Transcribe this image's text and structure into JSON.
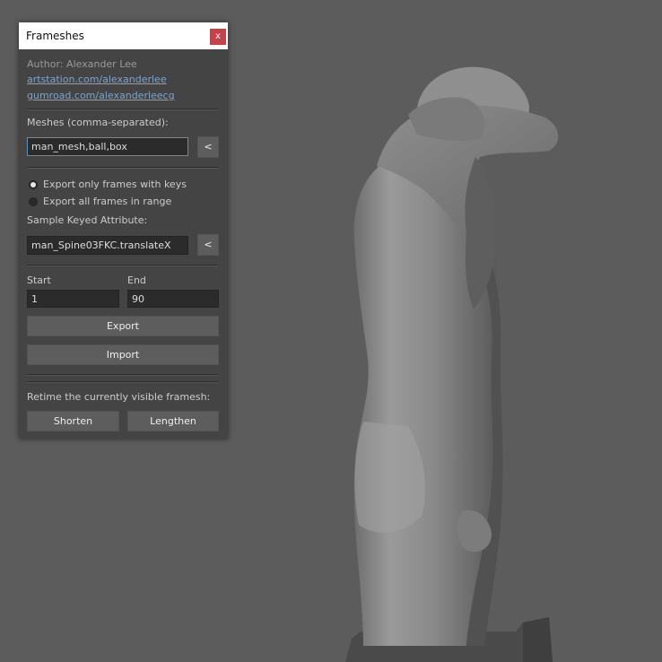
{
  "window": {
    "title": "Frameshes",
    "close_label": "x"
  },
  "author": {
    "text": "Author: Alexander Lee",
    "link1": "artstation.com/alexanderlee",
    "link2": "gumroad.com/alexanderleecg"
  },
  "meshes": {
    "label": "Meshes (comma-separated):",
    "value": "man_mesh,ball,box",
    "pick_label": "<"
  },
  "export_mode": {
    "option1": "Export only frames with keys",
    "option2": "Export all frames in range",
    "selected": "option1"
  },
  "sample_attr": {
    "label": "Sample Keyed Attribute:",
    "value": "man_Spine03FKC.translateX",
    "pick_label": "<"
  },
  "range": {
    "start_label": "Start",
    "end_label": "End",
    "start_value": "1",
    "end_value": "90"
  },
  "actions": {
    "export_label": "Export",
    "import_label": "Import"
  },
  "retime": {
    "label": "Retime the currently visible framesh:",
    "shorten_label": "Shorten",
    "lengthen_label": "Lengthen"
  },
  "colors": {
    "viewport_bg": "#5c5c5c",
    "panel_bg": "#444444",
    "close_button": "#c64249",
    "link": "#7ea3cf",
    "focus_border": "#5d8fba"
  }
}
